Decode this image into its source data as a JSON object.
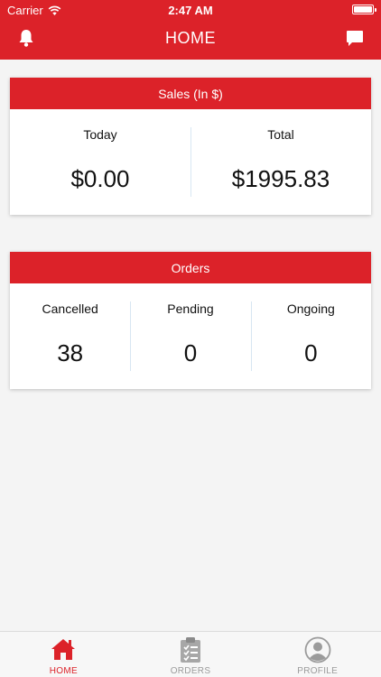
{
  "status_bar": {
    "carrier": "Carrier",
    "time": "2:47 AM"
  },
  "header": {
    "title": "HOME",
    "left_icon": "bell-icon",
    "right_icon": "chat-icon"
  },
  "sales": {
    "title": "Sales (In $)",
    "today_label": "Today",
    "today_value": "$0.00",
    "total_label": "Total",
    "total_value": "$1995.83"
  },
  "orders": {
    "title": "Orders",
    "cancelled_label": "Cancelled",
    "cancelled_value": "38",
    "pending_label": "Pending",
    "pending_value": "0",
    "ongoing_label": "Ongoing",
    "ongoing_value": "0"
  },
  "tabs": [
    {
      "label": "HOME",
      "icon": "home-icon",
      "active": true
    },
    {
      "label": "ORDERS",
      "icon": "clipboard-icon",
      "active": false
    },
    {
      "label": "PROFILE",
      "icon": "user-icon",
      "active": false
    }
  ],
  "colors": {
    "accent": "#dc2229",
    "inactive": "#9b9b9b",
    "divider": "#d7e6f2"
  }
}
